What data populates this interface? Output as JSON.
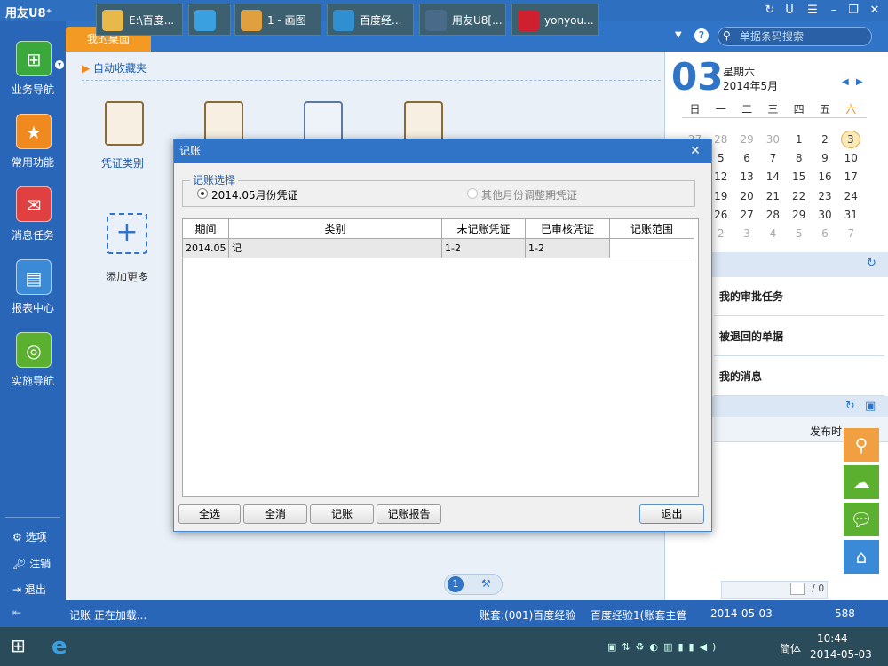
{
  "app": {
    "title": "用友U8⁺"
  },
  "sidebar": {
    "items": [
      {
        "label": "业务导航",
        "icon": "tree-icon",
        "color": "#3aa83a"
      },
      {
        "label": "常用功能",
        "icon": "star-icon",
        "color": "#f08a1f"
      },
      {
        "label": "消息任务",
        "icon": "message-icon",
        "color": "#e04040"
      },
      {
        "label": "报表中心",
        "icon": "report-icon",
        "color": "#3b8ad8"
      },
      {
        "label": "实施导航",
        "icon": "compass-icon",
        "color": "#5bb030"
      }
    ],
    "bottom": [
      {
        "label": "选项",
        "icon": "gear-icon"
      },
      {
        "label": "注销",
        "icon": "key-icon"
      },
      {
        "label": "退出",
        "icon": "exit-icon"
      }
    ]
  },
  "header": {
    "desk_tab": "我的桌面",
    "search_placeholder": "单据条码搜索"
  },
  "desktop": {
    "fav_title": "自动收藏夹",
    "apps": [
      {
        "label": "凭证类别"
      }
    ],
    "add_more": "添加更多"
  },
  "calendar": {
    "day": "03",
    "weekday": "星期六",
    "month": "2014年5月",
    "headers": [
      "日",
      "一",
      "二",
      "三",
      "四",
      "五",
      "六"
    ],
    "weeks": [
      [
        "27",
        "28",
        "29",
        "30",
        "1",
        "2",
        "3"
      ],
      [
        "4",
        "5",
        "6",
        "7",
        "8",
        "9",
        "10"
      ],
      [
        "11",
        "12",
        "13",
        "14",
        "15",
        "16",
        "17"
      ],
      [
        "18",
        "19",
        "20",
        "21",
        "22",
        "23",
        "24"
      ],
      [
        "25",
        "26",
        "27",
        "28",
        "29",
        "30",
        "31"
      ],
      [
        "1",
        "2",
        "3",
        "4",
        "5",
        "6",
        "7"
      ]
    ]
  },
  "tasks": {
    "items": [
      "我的审批任务",
      "被退回的单据",
      "我的消息"
    ],
    "publish_label": "发布时"
  },
  "dialog": {
    "title": "记账",
    "group_label": "记账选择",
    "option1": "2014.05月份凭证",
    "option2": "其他月份调整期凭证",
    "columns": [
      "期间",
      "类别",
      "未记账凭证",
      "已审核凭证",
      "记账范围"
    ],
    "rows": [
      [
        "2014.05",
        "记",
        "1-2",
        "1-2",
        ""
      ]
    ],
    "buttons": {
      "select_all": "全选",
      "deselect_all": "全消",
      "post": "记账",
      "report": "记账报告",
      "exit": "退出"
    }
  },
  "status": {
    "left": "记账 正在加载...",
    "account": "账套:(001)百度经验",
    "user": "百度经验1(账套主管",
    "date": "2014-05-03",
    "extra": "588"
  },
  "pager": {
    "page": "1"
  },
  "taskbar": {
    "items": [
      {
        "label": "E:\\百度...",
        "color": "#e8b94a"
      },
      {
        "label": "",
        "color": "#3aa0e0"
      },
      {
        "label": "1 - 画图",
        "color": "#e0a040"
      },
      {
        "label": "百度经...",
        "color": "#2f8fd0"
      },
      {
        "label": "用友U8[...",
        "color": "#4a6a8a"
      },
      {
        "label": "yonyou...",
        "color": "#d02030"
      }
    ],
    "ime": "简体",
    "time": "10:44",
    "date": "2014-05-03"
  }
}
